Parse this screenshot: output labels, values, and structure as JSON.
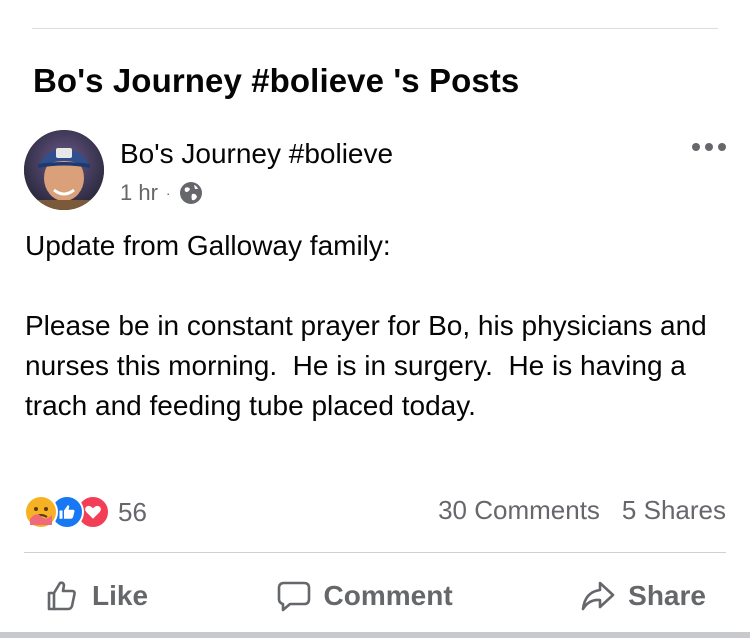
{
  "section": {
    "title": "Bo's Journey #bolieve 's Posts"
  },
  "post": {
    "author": "Bo's Journey #bolieve",
    "time": "1 hr",
    "separator": "·",
    "audience_icon": "globe-icon",
    "more_icon": "more-dots-icon",
    "body_line_1": "Update from Galloway family:",
    "body_line_2": "Please be in constant prayer for Bo, his physicians and nurses this morning.  He is in surgery.  He is having a trach and feeding tube placed today."
  },
  "stats": {
    "reaction_icons": [
      "care-reaction-icon",
      "like-reaction-icon",
      "love-reaction-icon"
    ],
    "reaction_count": "56",
    "comments": "30 Comments",
    "shares": "5 Shares"
  },
  "actions": {
    "like": "Like",
    "comment": "Comment",
    "share": "Share"
  },
  "colors": {
    "text_primary": "#050505",
    "text_secondary": "#65676b",
    "like_blue": "#1877f2",
    "love_red": "#f33e58",
    "care_yellow": "#f7b125"
  }
}
